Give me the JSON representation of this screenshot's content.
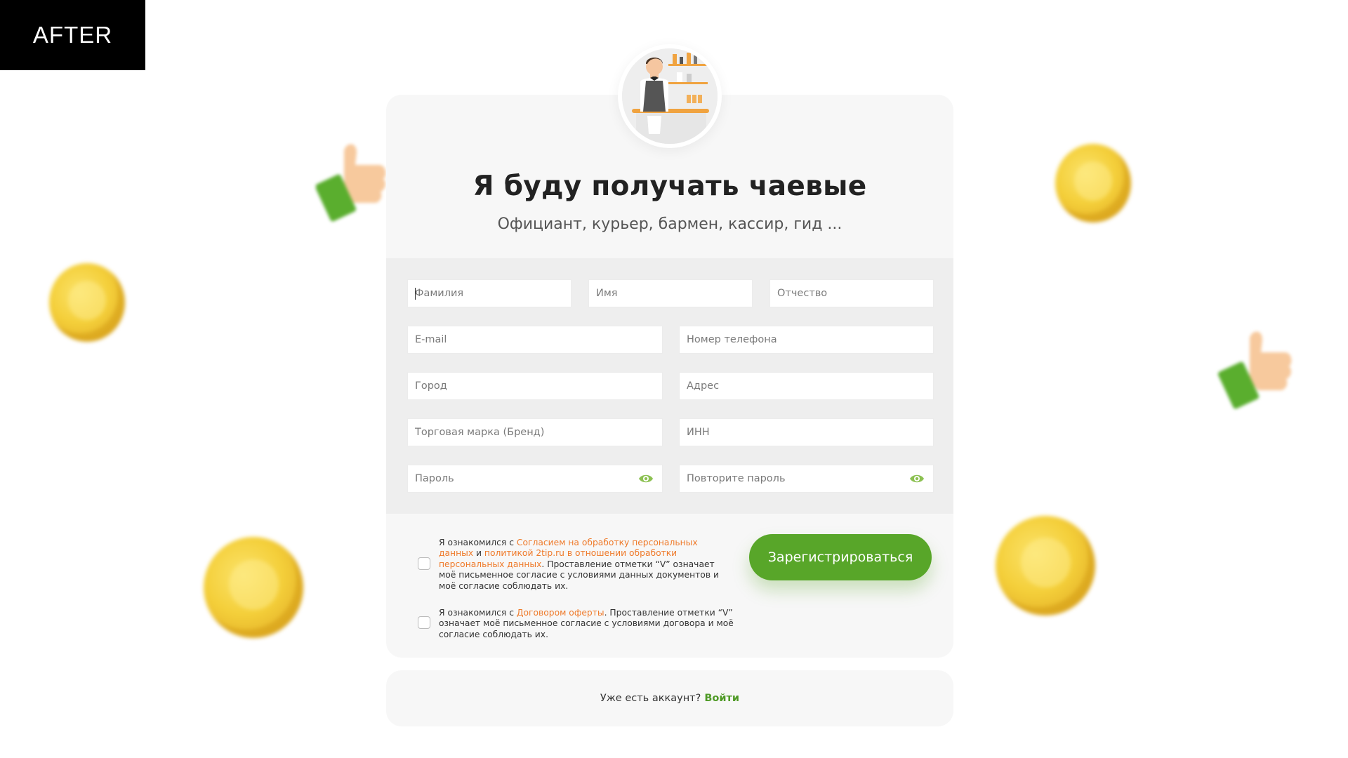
{
  "badge": "AFTER",
  "header": {
    "title": "Я буду получать чаевые",
    "subtitle": "Официант, курьер, бармен, кассир, гид ..."
  },
  "form": {
    "last_name_placeholder": "Фамилия",
    "first_name_placeholder": "Имя",
    "middle_name_placeholder": "Отчество",
    "email_placeholder": "E-mail",
    "phone_placeholder": "Номер телефона",
    "city_placeholder": "Город",
    "address_placeholder": "Адрес",
    "brand_placeholder": "Торговая марка (Бренд)",
    "inn_placeholder": "ИНН",
    "password_placeholder": "Пароль",
    "repeat_password_placeholder": "Повторите пароль"
  },
  "consent1": {
    "prefix": "Я ознакомился с ",
    "link1": "Согласием на обработку персональных данных",
    "mid": " и ",
    "link2": "политикой 2tip.ru в отношении обработки персональных данных",
    "suffix": ". Проставление отметки “V” означает моё письменное согласие с условиями данных документов и моё согласие соблюдать их."
  },
  "consent2": {
    "prefix": "Я ознакомился с ",
    "link": "Договором оферты",
    "suffix": ". Проставление отметки “V” означает моё письменное согласие с условиями договора и моё согласие соблюдать их."
  },
  "register_button": "Зарегистрироваться",
  "login": {
    "question": "Уже есть аккаунт?",
    "link": "Войти"
  },
  "colors": {
    "accent_green": "#58a629",
    "link_orange": "#ef7a2a",
    "coin_yellow": "#f4cf3a"
  }
}
